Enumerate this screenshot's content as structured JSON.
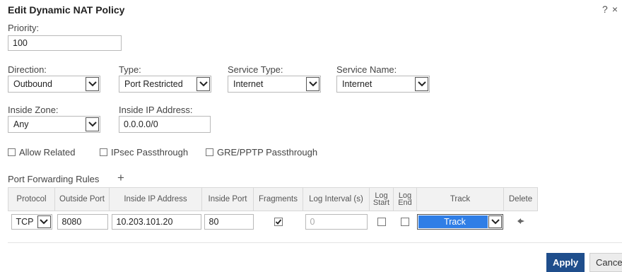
{
  "dialog": {
    "title": "Edit Dynamic NAT Policy",
    "help_icon": "?",
    "close_icon": "×"
  },
  "priority": {
    "label": "Priority:",
    "value": "100"
  },
  "direction": {
    "label": "Direction:",
    "value": "Outbound"
  },
  "type": {
    "label": "Type:",
    "value": "Port Restricted"
  },
  "service_type": {
    "label": "Service Type:",
    "value": "Internet"
  },
  "service_name": {
    "label": "Service Name:",
    "value": "Internet"
  },
  "inside_zone": {
    "label": "Inside Zone:",
    "value": "Any"
  },
  "inside_ip": {
    "label": "Inside IP Address:",
    "value": "0.0.0.0/0"
  },
  "options": {
    "allow_related": {
      "label": "Allow Related",
      "checked": false
    },
    "ipsec": {
      "label": "IPsec Passthrough",
      "checked": false
    },
    "gre": {
      "label": "GRE/PPTP Passthrough",
      "checked": false
    }
  },
  "port_forwarding": {
    "label": "Port Forwarding Rules",
    "add_icon": "+",
    "columns": {
      "protocol": "Protocol",
      "outside_port": "Outside Port",
      "inside_ip": "Inside IP Address",
      "inside_port": "Inside Port",
      "fragments": "Fragments",
      "log_interval": "Log Interval (s)",
      "log_start_1": "Log",
      "log_start_2": "Start",
      "log_end_1": "Log",
      "log_end_2": "End",
      "track": "Track",
      "delete": "Delete"
    },
    "rows": [
      {
        "protocol": "TCP",
        "outside_port": "8080",
        "inside_ip": "10.203.101.20",
        "inside_port": "80",
        "fragments": true,
        "log_interval": "0",
        "log_start": false,
        "log_end": false,
        "track": "Track"
      }
    ]
  },
  "actions": {
    "apply": "Apply",
    "cancel": "Cancel"
  },
  "colors": {
    "apply_bg": "#1f4e8c",
    "track_highlight": "#2f7ee6"
  }
}
